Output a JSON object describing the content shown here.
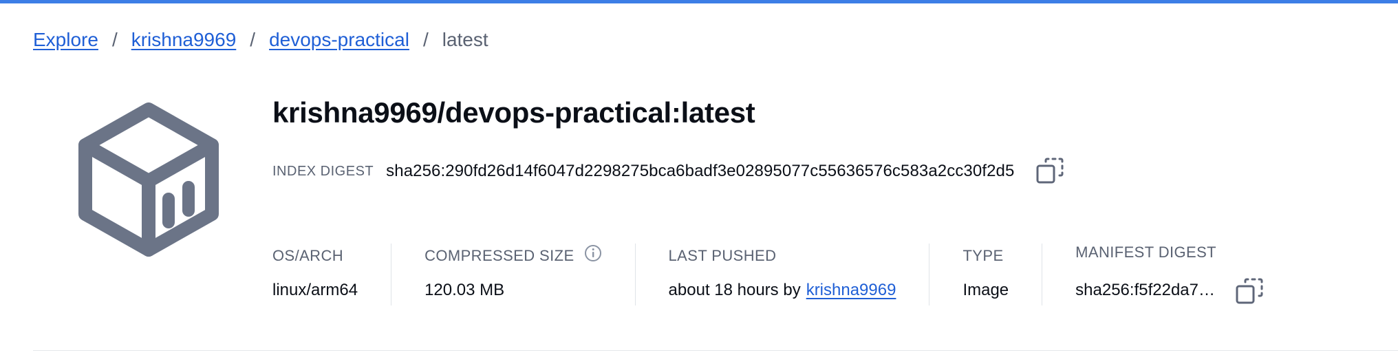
{
  "accent_color": "#3d7ee6",
  "breadcrumb": {
    "items": [
      {
        "label": "Explore"
      },
      {
        "label": "krishna9969"
      },
      {
        "label": "devops-practical"
      }
    ],
    "current": "latest",
    "separator": "/"
  },
  "image": {
    "icon": "container-cube-icon",
    "title": "krishna9969/devops-practical:latest",
    "index_digest_label": "INDEX DIGEST",
    "index_digest": "sha256:290fd26d14f6047d2298275bca6badf3e02895077c55636576c583a2cc30f2d5"
  },
  "meta": {
    "os_arch": {
      "label": "OS/ARCH",
      "value": "linux/arm64"
    },
    "compressed_size": {
      "label": "COMPRESSED SIZE",
      "value": "120.03 MB"
    },
    "last_pushed": {
      "label": "LAST PUSHED",
      "value": "about 18 hours by",
      "user": "krishna9969"
    },
    "type": {
      "label": "TYPE",
      "value": "Image"
    },
    "manifest_digest": {
      "label": "MANIFEST DIGEST",
      "value": "sha256:f5f22da7…"
    }
  }
}
